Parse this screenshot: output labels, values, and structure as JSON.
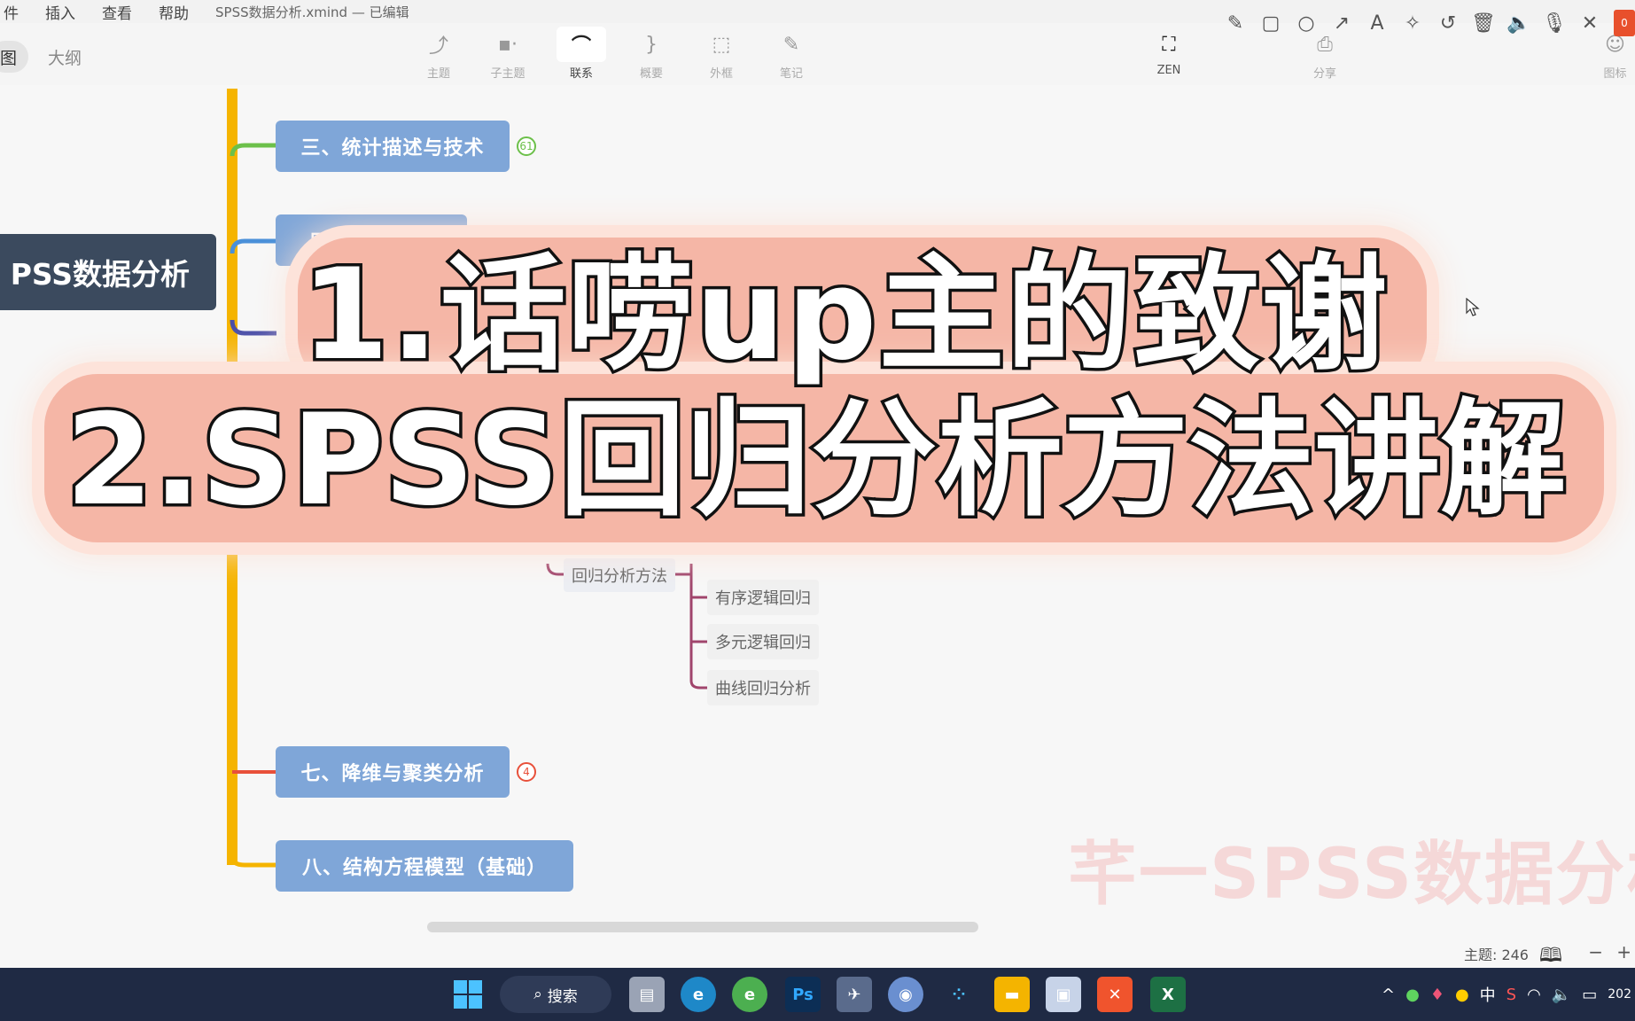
{
  "menu": {
    "items": [
      "插入",
      "查看",
      "帮助"
    ],
    "filename": "SPSS数据分析.xmind",
    "status": "— 已编辑"
  },
  "toolbar": {
    "view_tabs": [
      "图",
      "大纲"
    ],
    "tools": [
      {
        "label": "主题",
        "icon": "topic-icon",
        "glyph": "⤴"
      },
      {
        "label": "子主题",
        "icon": "subtopic-icon",
        "glyph": "▪·"
      },
      {
        "label": "联系",
        "icon": "relationship-icon",
        "glyph": "⌒"
      },
      {
        "label": "概要",
        "icon": "summary-icon",
        "glyph": "}"
      },
      {
        "label": "外框",
        "icon": "boundary-icon",
        "glyph": "⬚"
      },
      {
        "label": "笔记",
        "icon": "note-icon",
        "glyph": "✎"
      }
    ],
    "zen_label": "ZEN",
    "share_label": "分享",
    "icon_label": "图标"
  },
  "drawbar": {
    "tools": [
      "pencil-icon",
      "rectangle-icon",
      "circle-icon",
      "arrow-icon",
      "text-icon",
      "magic-wand-icon",
      "undo-icon",
      "trash-icon",
      "speaker-icon",
      "microphone-icon",
      "close-icon"
    ],
    "record_label": "0"
  },
  "mindmap": {
    "root": "PSS数据分析",
    "branches": [
      {
        "label": "三、统计描述与技术",
        "badge": "61",
        "color": "#6cc04a"
      },
      {
        "label": "四、差异性分",
        "badge": "",
        "color": "#4a90d9"
      },
      {
        "label": "七、降维与聚类分析",
        "badge": "4",
        "color": "#e8503a"
      },
      {
        "label": "八、结构方程模型（基础）",
        "badge": "",
        "color": "#f5a623"
      }
    ],
    "regression_label": "回归分析方法",
    "regression_children": [
      "有序逻辑回归",
      "多元逻辑回归",
      "曲线回归分析"
    ]
  },
  "overlay": {
    "line1": "1.话唠up主的致谢",
    "line2": "2.SPSS回归分析方法讲解"
  },
  "watermark": "芊一SPSS数据分析",
  "statusbar": {
    "topic_count": "主题: 246",
    "zoom_out": "−",
    "zoom_in": "+"
  },
  "taskbar": {
    "search_label": "搜索",
    "apps": [
      "start-icon",
      "file-manager-icon",
      "edge-icon",
      "browser-icon",
      "photoshop-icon",
      "app-icon",
      "globe-icon",
      "dots-icon",
      "folder-icon",
      "image-viewer-icon",
      "xmind-icon",
      "excel-icon"
    ],
    "tray_ime": "中",
    "clock": "202"
  }
}
